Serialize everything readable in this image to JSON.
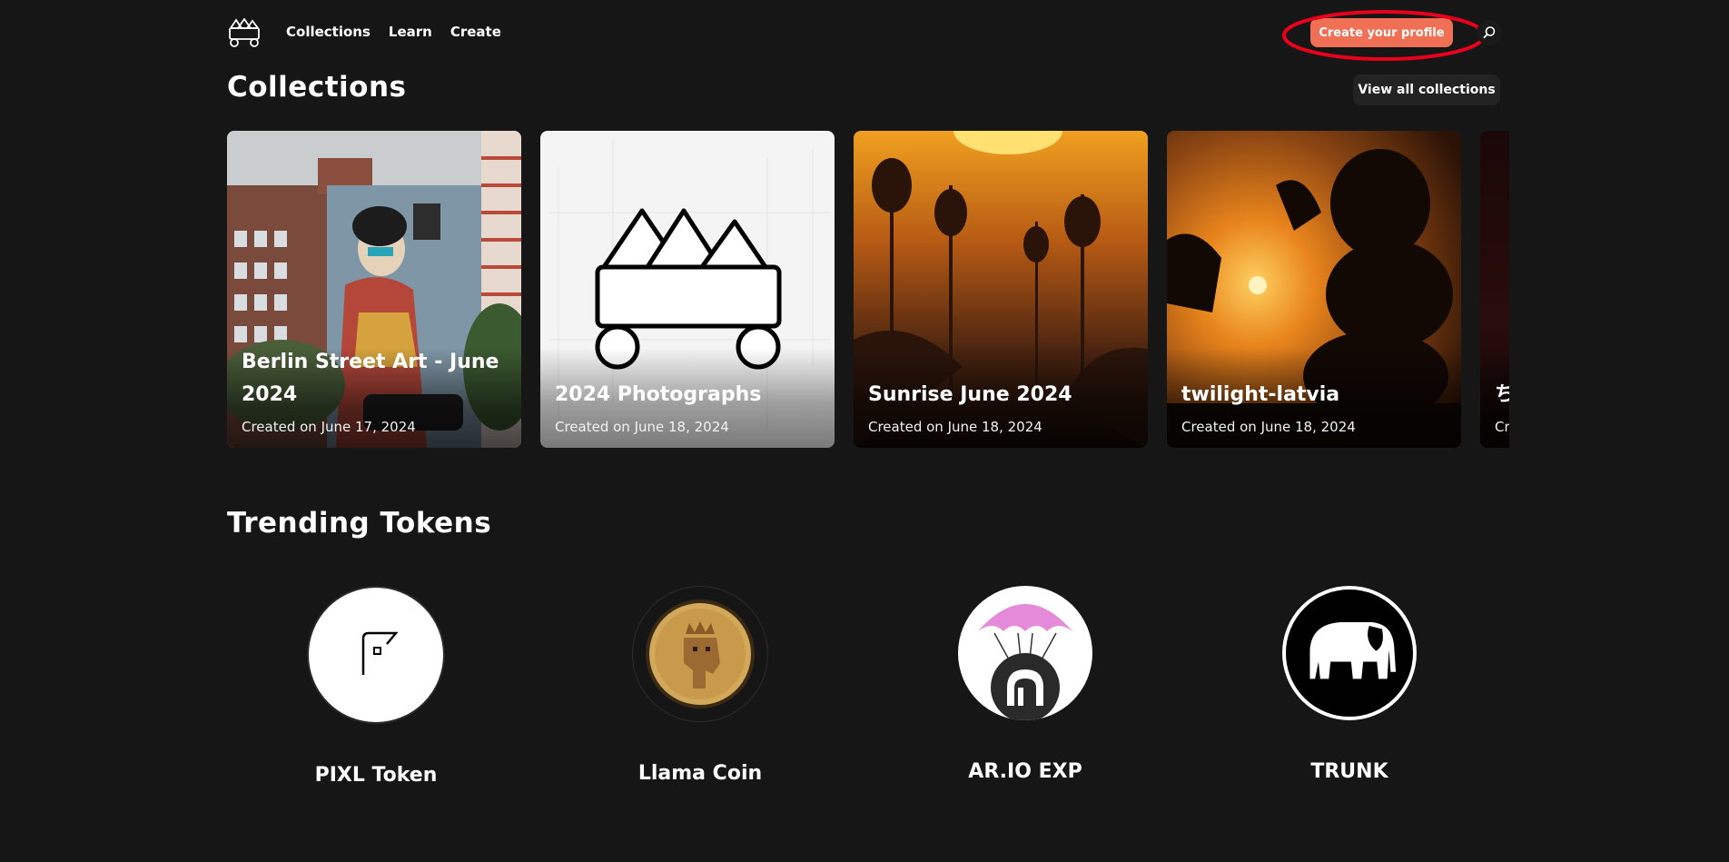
{
  "nav": {
    "links": [
      "Collections",
      "Learn",
      "Create"
    ],
    "profile_button": "Create your profile",
    "logo_icon": "mining-cart-icon",
    "search_icon": "search-icon",
    "accent": "#f07055",
    "highlight": "#e8001c"
  },
  "collections": {
    "title": "Collections",
    "view_all": "View all collections",
    "cards": [
      {
        "title": "Berlin Street Art - June 2024",
        "date": "Created on June 17, 2024"
      },
      {
        "title": "2024 Photographs",
        "date": "Created on June 18, 2024"
      },
      {
        "title": "Sunrise June 2024",
        "date": "Created on June 18, 2024"
      },
      {
        "title": "twilight-latvia",
        "date": "Created on June 18, 2024"
      },
      {
        "title": "ち",
        "date": "Cr"
      }
    ]
  },
  "trending": {
    "title": "Trending Tokens",
    "tokens": [
      {
        "name": "PIXL Token"
      },
      {
        "name": "Llama Coin"
      },
      {
        "name": "AR.IO EXP"
      },
      {
        "name": "TRUNK"
      }
    ]
  }
}
